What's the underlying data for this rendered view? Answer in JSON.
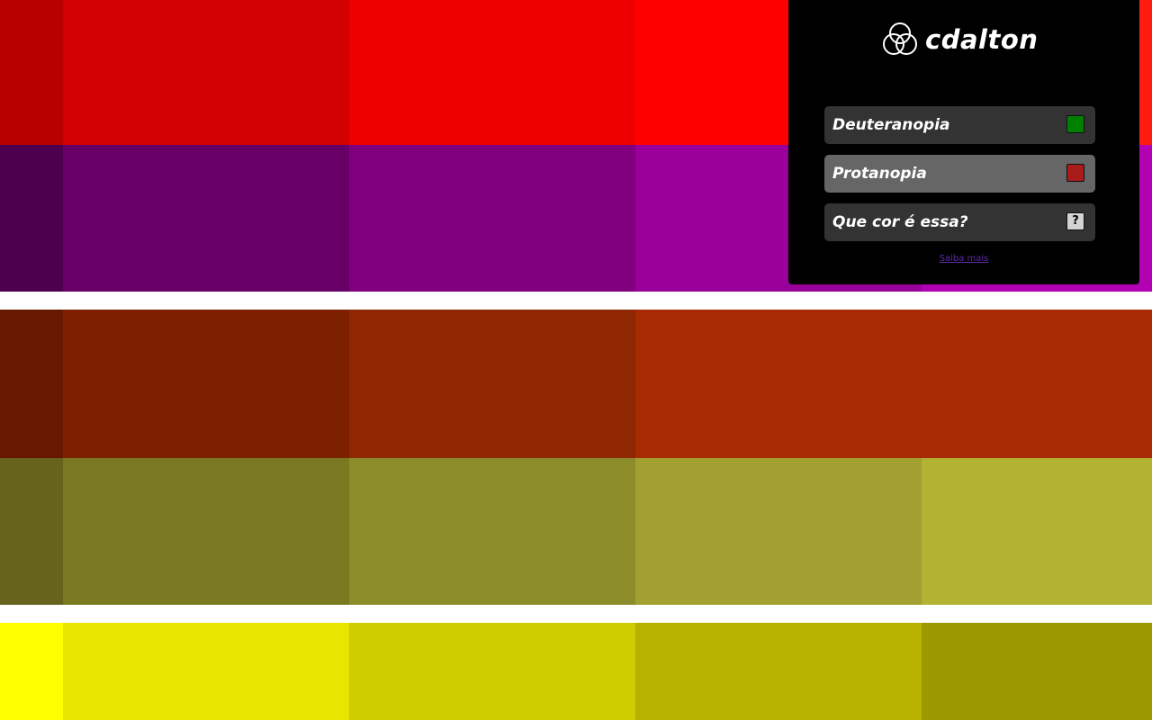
{
  "background": {
    "rows": [
      {
        "colors": [
          "#b90000",
          "#d20000",
          "#ee0000",
          "#ff0000",
          "#ff1b0e"
        ]
      },
      {
        "colors": [
          "#4d004d",
          "#660066",
          "#800080",
          "#990099",
          "#b300b3"
        ]
      },
      {
        "colors": [
          "#681800",
          "#7d2000",
          "#8f2703",
          "#a72a03",
          "#a82b05"
        ]
      },
      {
        "colors": [
          "#66641c",
          "#7a7922",
          "#8c8c2b",
          "#a2a030",
          "#b3b333"
        ]
      },
      {
        "colors": [
          "#ffff00",
          "#e7e600",
          "#cfcc00",
          "#b7b300",
          "#9c9900"
        ]
      }
    ]
  },
  "panel": {
    "brand": "cdalton",
    "logo_icon": "three-circles-icon",
    "modes": [
      {
        "id": "deuteranopia",
        "label": "Deuteranopia",
        "swatch_color": "#008000",
        "active": false
      },
      {
        "id": "protanopia",
        "label": "Protanopia",
        "swatch_color": "#a81c1c",
        "active": true
      },
      {
        "id": "que-cor",
        "label": "Que cor é essa?",
        "help_glyph": "?",
        "active": false
      }
    ],
    "learn_more": "Saiba mais",
    "colors": {
      "panel_bg": "#000000",
      "button_bg": "#333333",
      "button_active_bg": "#666666",
      "link": "#5b2ba8"
    }
  }
}
